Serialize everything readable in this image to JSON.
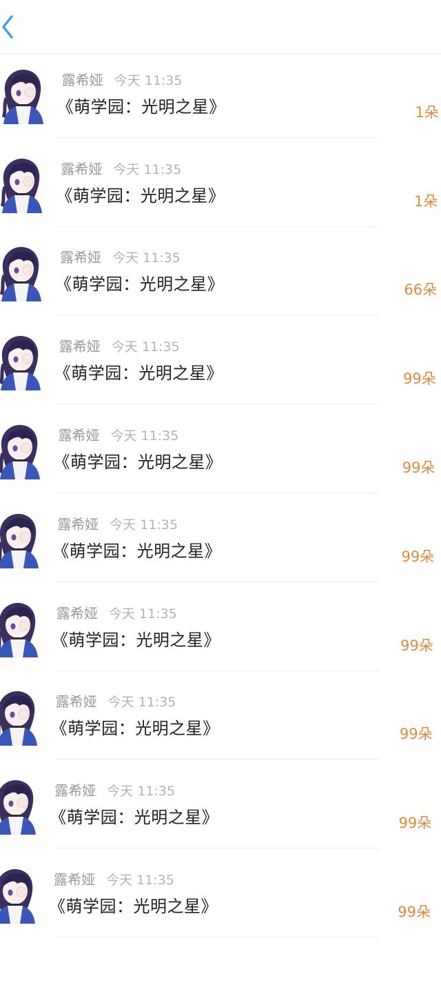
{
  "nav": {
    "back_icon": "chevron-left-icon",
    "accent_color": "#3d9bf0"
  },
  "gift_color": "#e08a3e",
  "records": [
    {
      "name": "",
      "time": "",
      "title": "《萌学园：光明之星》",
      "amount": "1朵",
      "avatar": "anime-girl-avatar"
    },
    {
      "name": "露希娅",
      "time": "今天 11:35",
      "title": "《萌学园：光明之星》",
      "amount": "1朵",
      "avatar": "anime-girl-avatar"
    },
    {
      "name": "露希娅",
      "time": "今天 11:35",
      "title": "《萌学园：光明之星》",
      "amount": "1朵",
      "avatar": "anime-girl-avatar"
    },
    {
      "name": "露希娅",
      "time": "今天 11:35",
      "title": "《萌学园：光明之星》",
      "amount": "66朵",
      "avatar": "anime-girl-avatar"
    },
    {
      "name": "露希娅",
      "time": "今天 11:35",
      "title": "《萌学园：光明之星》",
      "amount": "99朵",
      "avatar": "anime-girl-avatar"
    },
    {
      "name": "露希娅",
      "time": "今天 11:35",
      "title": "《萌学园：光明之星》",
      "amount": "99朵",
      "avatar": "anime-girl-avatar"
    },
    {
      "name": "露希娅",
      "time": "今天 11:35",
      "title": "《萌学园：光明之星》",
      "amount": "99朵",
      "avatar": "anime-girl-avatar"
    },
    {
      "name": "露希娅",
      "time": "今天 11:35",
      "title": "《萌学园：光明之星》",
      "amount": "99朵",
      "avatar": "anime-girl-avatar"
    },
    {
      "name": "露希娅",
      "time": "今天 11:35",
      "title": "《萌学园：光明之星》",
      "amount": "99朵",
      "avatar": "anime-girl-avatar"
    },
    {
      "name": "露希娅",
      "time": "今天 11:35",
      "title": "《萌学园：光明之星》",
      "amount": "99朵",
      "avatar": "anime-girl-avatar"
    },
    {
      "name": "露希娅",
      "time": "今天 11:35",
      "title": "《萌学园：光明之星》",
      "amount": "99朵",
      "avatar": "anime-girl-avatar"
    }
  ]
}
